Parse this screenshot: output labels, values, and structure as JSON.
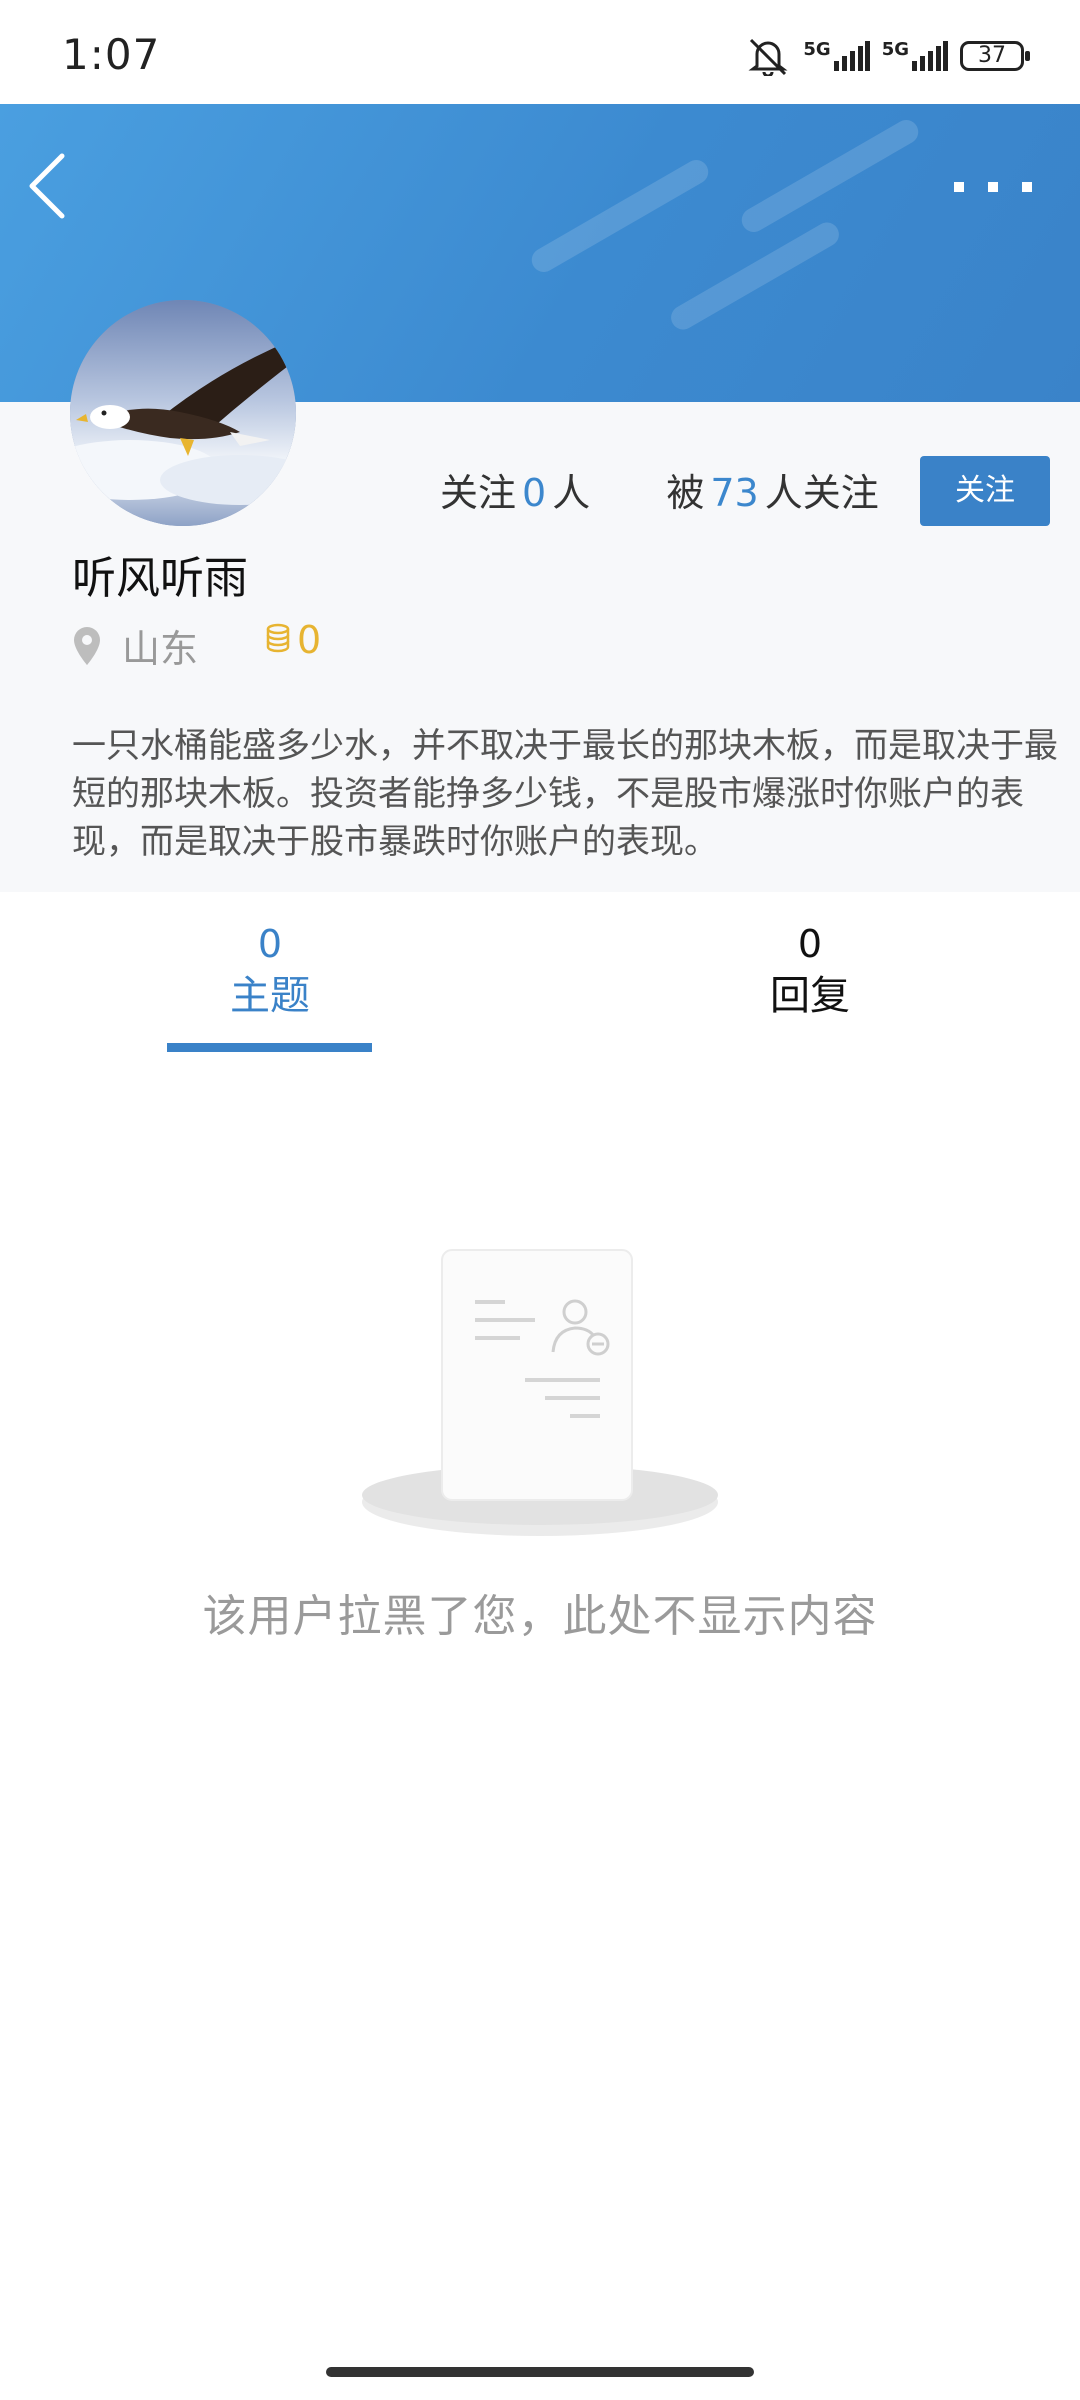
{
  "status_bar": {
    "time": "1:07",
    "network_1": "5G",
    "network_2": "5G",
    "battery": "37"
  },
  "header": {
    "back_icon": "chevron-left-icon",
    "more_icon": "more-dots-icon"
  },
  "profile": {
    "username": "听风听雨",
    "location": "山东",
    "coins": "0",
    "following": {
      "prefix": "关注",
      "count": "0",
      "suffix": "人"
    },
    "followers": {
      "prefix": "被",
      "count": "73",
      "suffix": "人关注"
    },
    "follow_button": "关注",
    "bio": "一只水桶能盛多少水，并不取决于最长的那块木板，而是取决于最短的那块木板。投资者能挣多少钱，不是股市爆涨时你账户的表现，而是取决于股市暴跌时你账户的表现。"
  },
  "tabs": [
    {
      "count": "0",
      "label": "主题",
      "active": true
    },
    {
      "count": "0",
      "label": "回复",
      "active": false
    }
  ],
  "empty_state": {
    "message": "该用户拉黑了您，此处不显示内容"
  },
  "colors": {
    "accent": "#3a82c8",
    "banner": "#4a9fe0",
    "coin": "#e7b431"
  }
}
